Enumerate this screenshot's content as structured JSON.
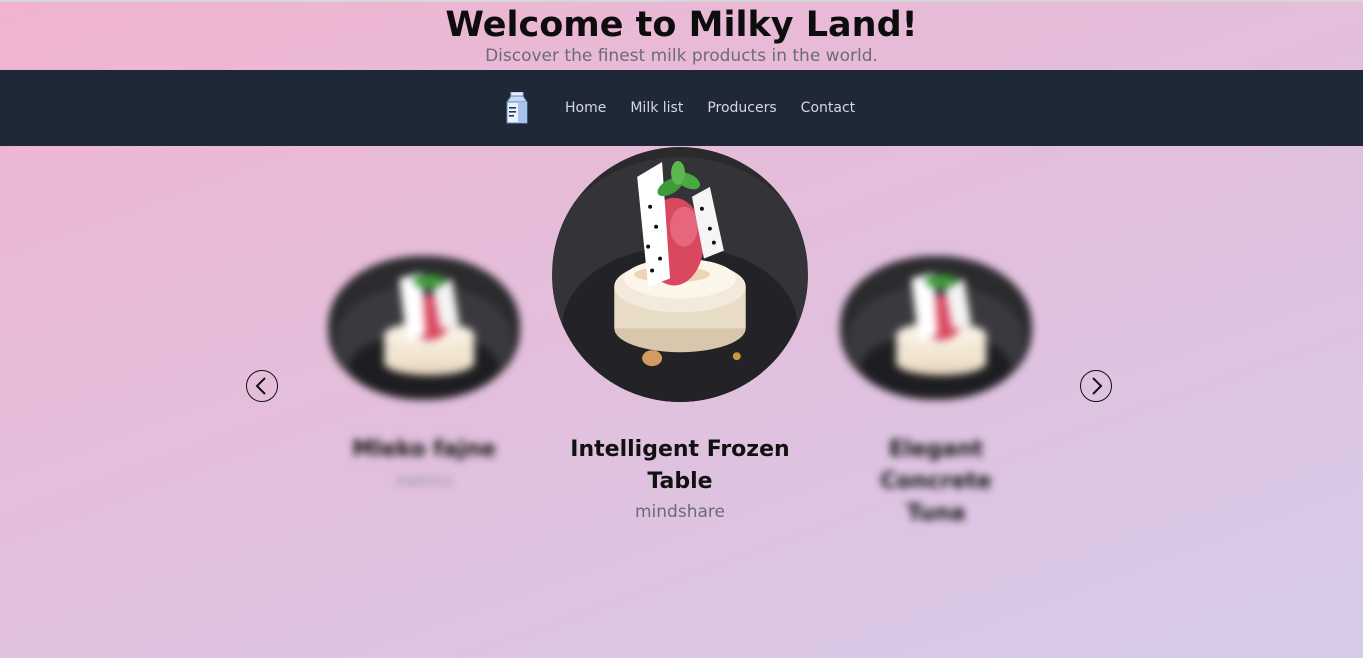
{
  "header": {
    "title": "Welcome to Milky Land!",
    "subtitle": "Discover the finest milk products in the world."
  },
  "nav": {
    "logo_icon": "milk-carton-icon",
    "items": [
      {
        "label": "Home"
      },
      {
        "label": "Milk list"
      },
      {
        "label": "Producers"
      },
      {
        "label": "Contact"
      }
    ]
  },
  "carousel": {
    "prev_icon": "chevron-left-icon",
    "next_icon": "chevron-right-icon",
    "cards": [
      {
        "title": "Mleko fajne",
        "subtitle": "metrics",
        "image": "dessert-photo",
        "state": "blurred"
      },
      {
        "title": "Intelligent Frozen Table",
        "subtitle": "mindshare",
        "image": "dessert-photo",
        "state": "active"
      },
      {
        "title": "Elegant Concrete Tuna",
        "subtitle": "",
        "image": "dessert-photo",
        "state": "blurred"
      }
    ]
  },
  "colors": {
    "navbar": "#1f2836",
    "nav_text": "#d5d8de",
    "subtitle_text": "#6b6b75",
    "background_start": "#f0b3d0",
    "background_end": "#d7cbea"
  }
}
